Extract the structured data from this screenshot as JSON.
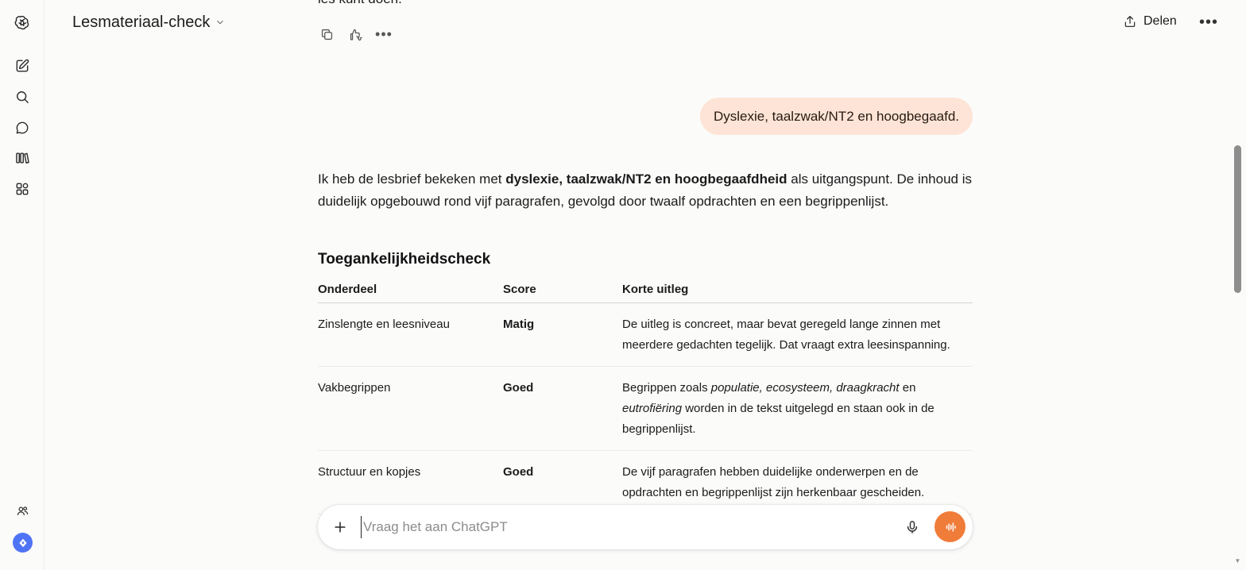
{
  "header": {
    "title": "Lesmateriaal-check",
    "share_label": "Delen"
  },
  "sidebar": {
    "items": [
      {
        "name": "new-chat-icon"
      },
      {
        "name": "search-icon"
      },
      {
        "name": "chats-icon"
      },
      {
        "name": "library-icon"
      },
      {
        "name": "apps-icon"
      }
    ],
    "bottom": [
      {
        "name": "group-icon"
      },
      {
        "name": "upgrade-icon"
      }
    ]
  },
  "conversation": {
    "previous_text": "les kunt doen.",
    "user_message": "Dyslexie, taalzwak/NT2 en hoogbegaafd.",
    "answer": {
      "intro_before": "Ik heb de lesbrief bekeken met ",
      "intro_bold": "dyslexie, taalzwak/NT2 en hoogbegaafdheid",
      "intro_after": " als uitgangspunt. De inhoud is duidelijk opgebouwd rond vijf paragrafen, gevolgd door twaalf opdrachten en een begrippenlijst.",
      "section_title": "Toegankelijkheidscheck",
      "table": {
        "headers": [
          "Onderdeel",
          "Score",
          "Korte uitleg"
        ],
        "rows": [
          {
            "part": "Zinslengte en leesniveau",
            "score": "Matig",
            "explanation": "De uitleg is concreet, maar bevat geregeld lange zinnen met meerdere gedachten tegelijk. Dat vraagt extra leesinspanning."
          },
          {
            "part": "Vakbegrippen",
            "score": "Goed",
            "explanation_pre": "Begrippen zoals ",
            "explanation_terms": "populatie, ecosysteem, draagkracht",
            "explanation_mid": " en ",
            "explanation_term2": "eutrofiëring",
            "explanation_post": " worden in de tekst uitgelegd en staan ook in de begrippenlijst."
          },
          {
            "part": "Structuur en kopjes",
            "score": "Goed",
            "explanation": "De vijf paragrafen hebben duidelijke onderwerpen en de opdrachten en begrippenlijst zijn herkenbaar gescheiden."
          }
        ]
      }
    }
  },
  "composer": {
    "placeholder": "Vraag het aan ChatGPT",
    "value": ""
  },
  "colors": {
    "user_bubble": "#fde4d6",
    "voice_button": "#f07c3a",
    "upgrade_badge": "#4f73f5"
  }
}
